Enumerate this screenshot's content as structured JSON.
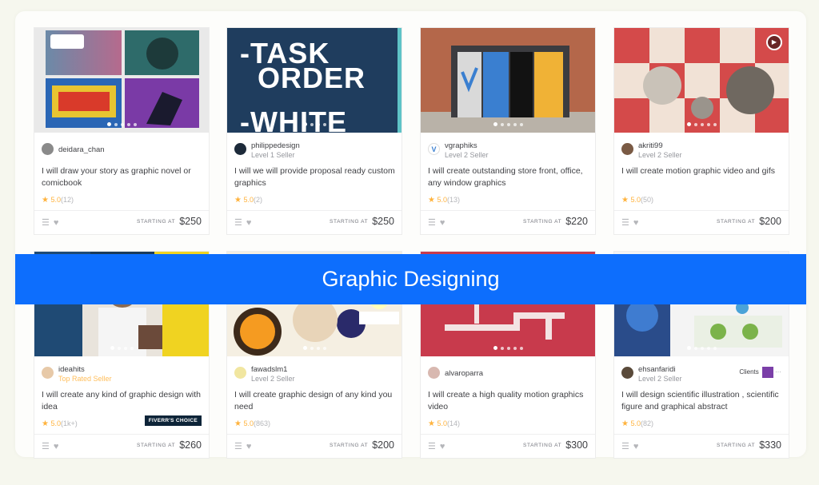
{
  "banner": "Graphic Designing",
  "starting_at": "STARTING AT",
  "cards": [
    {
      "seller": "deidara_chan",
      "level": "",
      "title": "I will draw your story as graphic novel or comicbook",
      "rating": "5.0",
      "count": "(12)",
      "price": "$250"
    },
    {
      "seller": "philippedesign",
      "level": "Level 1 Seller",
      "title": "I will we will provide proposal ready custom graphics",
      "rating": "5.0",
      "count": "(2)",
      "price": "$250",
      "thumb_text": [
        "-TASK",
        "ORDER",
        "-WHITE"
      ]
    },
    {
      "seller": "vgraphiks",
      "level": "Level 2 Seller",
      "title": "I will create outstanding store front, office, any window graphics",
      "rating": "5.0",
      "count": "(13)",
      "price": "$220"
    },
    {
      "seller": "akriti99",
      "level": "Level 2 Seller",
      "title": "I will create motion graphic video and gifs",
      "rating": "5.0",
      "count": "(50)",
      "price": "$200"
    },
    {
      "seller": "ideahits",
      "level": "Top Rated Seller",
      "title": "I will create any kind of graphic design with idea",
      "rating": "5.0",
      "count": "(1k+)",
      "price": "$260",
      "badge": "FIVERR'S CHOICE"
    },
    {
      "seller": "fawadslm1",
      "level": "Level 2 Seller",
      "title": "I will create graphic design of any kind you need",
      "rating": "5.0",
      "count": "(863)",
      "price": "$200"
    },
    {
      "seller": "alvaroparra",
      "level": "",
      "title": "I will create a high quality motion graphics video",
      "rating": "5.0",
      "count": "(14)",
      "price": "$300"
    },
    {
      "seller": "ehsanfaridi",
      "level": "Level 2 Seller",
      "title": "I will design scientific illustration , scientific figure and graphical abstract",
      "rating": "5.0",
      "count": "(82)",
      "price": "$330",
      "clients": "Clients"
    }
  ]
}
